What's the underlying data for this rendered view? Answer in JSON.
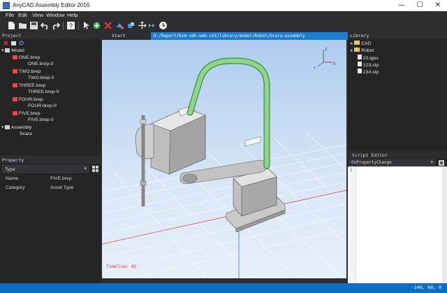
{
  "window": {
    "title": "AnyCAD Assembly Editor 2016",
    "minimize_glyph": "—",
    "maximize_glyph": "☐",
    "close_glyph": "✕"
  },
  "menu": [
    "File",
    "Edit",
    "View",
    "Window",
    "Help"
  ],
  "toolbar_icons": [
    "new-file-icon",
    "open-folder-icon",
    "save-icon",
    "undo-icon",
    "redo-icon",
    "help-icon",
    "pointer-icon",
    "add-part-icon",
    "delete-icon",
    "move-icon",
    "rotate-icon",
    "translate-icon",
    "connect-icon",
    "animate-clock-icon"
  ],
  "project": {
    "header": "Project",
    "tree": [
      {
        "label": "Model",
        "level": 1,
        "icon": "model-icon"
      },
      {
        "label": "ONE.brep",
        "level": 2,
        "icon": "part-icon"
      },
      {
        "label": "ONE.brep-0",
        "level": 3
      },
      {
        "label": "TWO.brep",
        "level": 2,
        "icon": "part-icon"
      },
      {
        "label": "TWO.brep-0",
        "level": 3
      },
      {
        "label": "THREE.brep",
        "level": 2,
        "icon": "part-icon"
      },
      {
        "label": "THREE.brep-0",
        "level": 3
      },
      {
        "label": "FOUR.brep",
        "level": 2,
        "icon": "part-icon"
      },
      {
        "label": "FOUR.brep-0",
        "level": 3
      },
      {
        "label": "FIVE.brep",
        "level": 2,
        "icon": "part-icon"
      },
      {
        "label": "FIVE.brep-0",
        "level": 3
      },
      {
        "label": "Assembly",
        "level": 1,
        "icon": "assembly-icon"
      },
      {
        "label": "Scara",
        "level": 2
      }
    ]
  },
  "property": {
    "header": "Property",
    "selector_value": "Type",
    "rows": [
      {
        "name": "Name",
        "value": "FIVE.brep"
      },
      {
        "name": "Category",
        "value": "Asset Type"
      }
    ]
  },
  "tabs": {
    "start": "Start",
    "path": "D:/Report/bim-sdk-web-cnt/library/model/Robot/Scara.assembly"
  },
  "viewport": {
    "overlay_text": "Timeline: 85",
    "axis_labels": {
      "x": "X",
      "y": "Y",
      "z": "Z"
    }
  },
  "library": {
    "header": "Library",
    "items": [
      {
        "label": "CAD",
        "type": "folder"
      },
      {
        "label": "Robot",
        "type": "folder"
      },
      {
        "label": "20.iges",
        "type": "file"
      },
      {
        "label": "123.stp",
        "type": "file"
      },
      {
        "label": "234.stp",
        "type": "file"
      }
    ]
  },
  "script_editor": {
    "header": "Script Editor",
    "event": "OnPropertyChange",
    "line_number": "1"
  },
  "status": {
    "coords": "-240, 60, 0"
  },
  "colors": {
    "accent": "#1e7bd0",
    "status_bar": "#0d6fc4",
    "robot_cable": "#8fd48a"
  }
}
